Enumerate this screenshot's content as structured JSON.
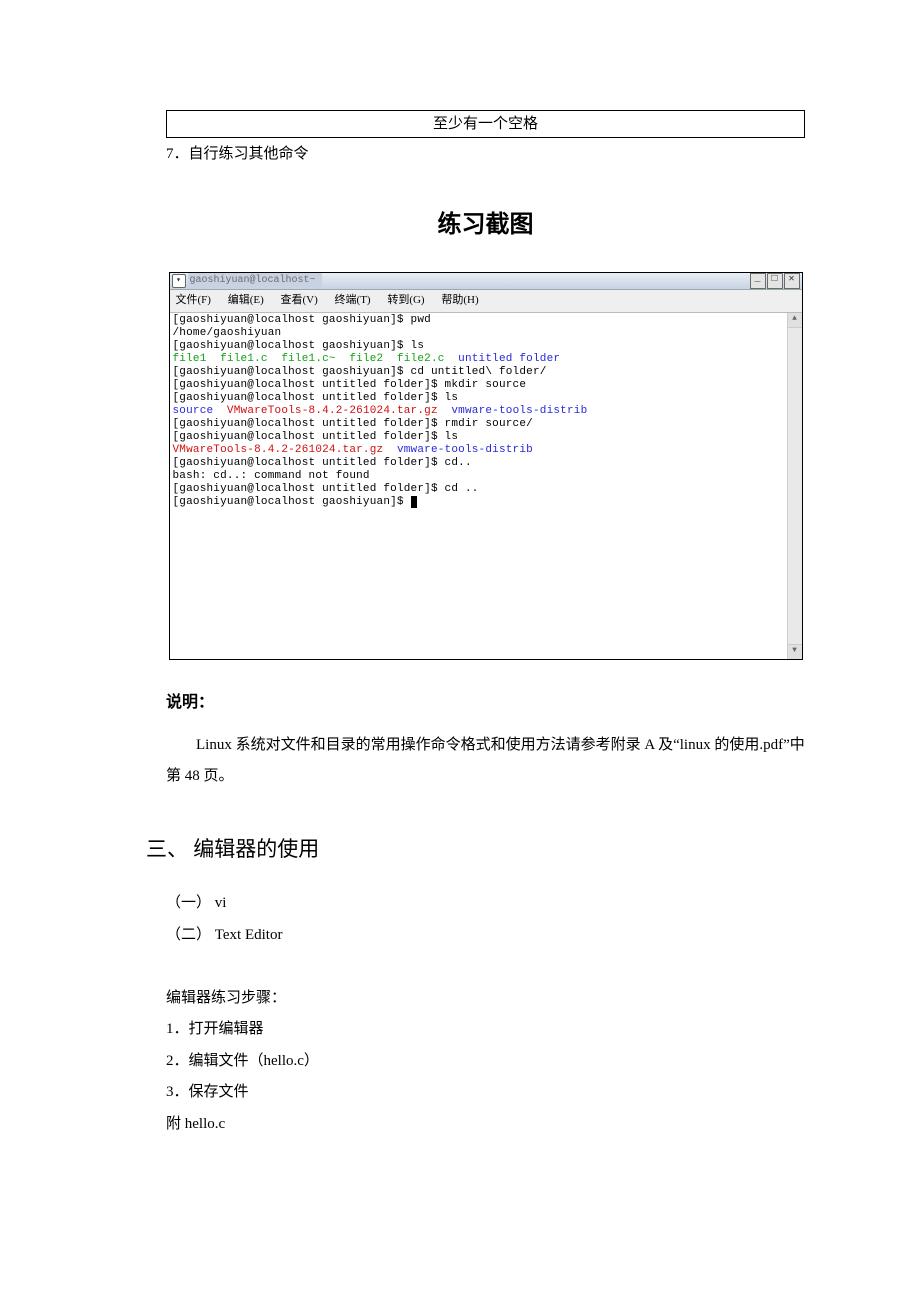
{
  "top_box": "至少有一个空格",
  "line7": "7．自行练习其他命令",
  "heading_practice": "练习截图",
  "terminal": {
    "title": "gaoshiyuan@localhost~",
    "menus": {
      "file": "文件(F)",
      "edit": "编辑(E)",
      "view": "查看(V)",
      "term": "终端(T)",
      "goto": "转到(G)",
      "help": "帮助(H)"
    },
    "winbtns": {
      "min": "_",
      "max": "□",
      "close": "✕"
    },
    "lines": [
      {
        "seg": [
          {
            "t": "[gaoshiyuan@localhost gaoshiyuan]$ pwd"
          }
        ]
      },
      {
        "seg": [
          {
            "t": "/home/gaoshiyuan"
          }
        ]
      },
      {
        "seg": [
          {
            "t": "[gaoshiyuan@localhost gaoshiyuan]$ ls"
          }
        ]
      },
      {
        "seg": [
          {
            "t": "file1  file1.c  file1.c~  ",
            "c": "t-green"
          },
          {
            "t": "file2  file2.c  ",
            "c": "t-green"
          },
          {
            "t": "untitled folder",
            "c": "t-blue"
          }
        ]
      },
      {
        "seg": [
          {
            "t": "[gaoshiyuan@localhost gaoshiyuan]$ cd untitled\\ folder/"
          }
        ]
      },
      {
        "seg": [
          {
            "t": "[gaoshiyuan@localhost untitled folder]$ mkdir source"
          }
        ]
      },
      {
        "seg": [
          {
            "t": "[gaoshiyuan@localhost untitled folder]$ ls"
          }
        ]
      },
      {
        "seg": [
          {
            "t": "source  ",
            "c": "t-blue"
          },
          {
            "t": "VMwareTools-8.4.2-261024.tar.gz  ",
            "c": "t-red"
          },
          {
            "t": "vmware-tools-distrib",
            "c": "t-blue"
          }
        ]
      },
      {
        "seg": [
          {
            "t": "[gaoshiyuan@localhost untitled folder]$ rmdir source/"
          }
        ]
      },
      {
        "seg": [
          {
            "t": "[gaoshiyuan@localhost untitled folder]$ ls"
          }
        ]
      },
      {
        "seg": [
          {
            "t": "VMwareTools-8.4.2-261024.tar.gz  ",
            "c": "t-red"
          },
          {
            "t": "vmware-tools-distrib",
            "c": "t-blue"
          }
        ]
      },
      {
        "seg": [
          {
            "t": "[gaoshiyuan@localhost untitled folder]$ cd.."
          }
        ]
      },
      {
        "seg": [
          {
            "t": "bash: cd..: command not found"
          }
        ]
      },
      {
        "seg": [
          {
            "t": "[gaoshiyuan@localhost untitled folder]$ cd .."
          }
        ]
      },
      {
        "seg": [
          {
            "t": "[gaoshiyuan@localhost gaoshiyuan]$ "
          },
          {
            "t": " ",
            "c": "cursor"
          }
        ]
      }
    ]
  },
  "shuoming_label": "说明：",
  "shuoming_text": "Linux 系统对文件和目录的常用操作命令格式和使用方法请参考附录 A 及“linux 的使用.pdf”中第 48 页。",
  "section3_title": "三、 编辑器的使用",
  "list": {
    "a": "（一） vi",
    "b": "（二） Text Editor",
    "steps_title": "编辑器练习步骤：",
    "s1": "1．打开编辑器",
    "s2": "2．编辑文件（hello.c）",
    "s3": "3．保存文件",
    "attach": "附 hello.c"
  }
}
